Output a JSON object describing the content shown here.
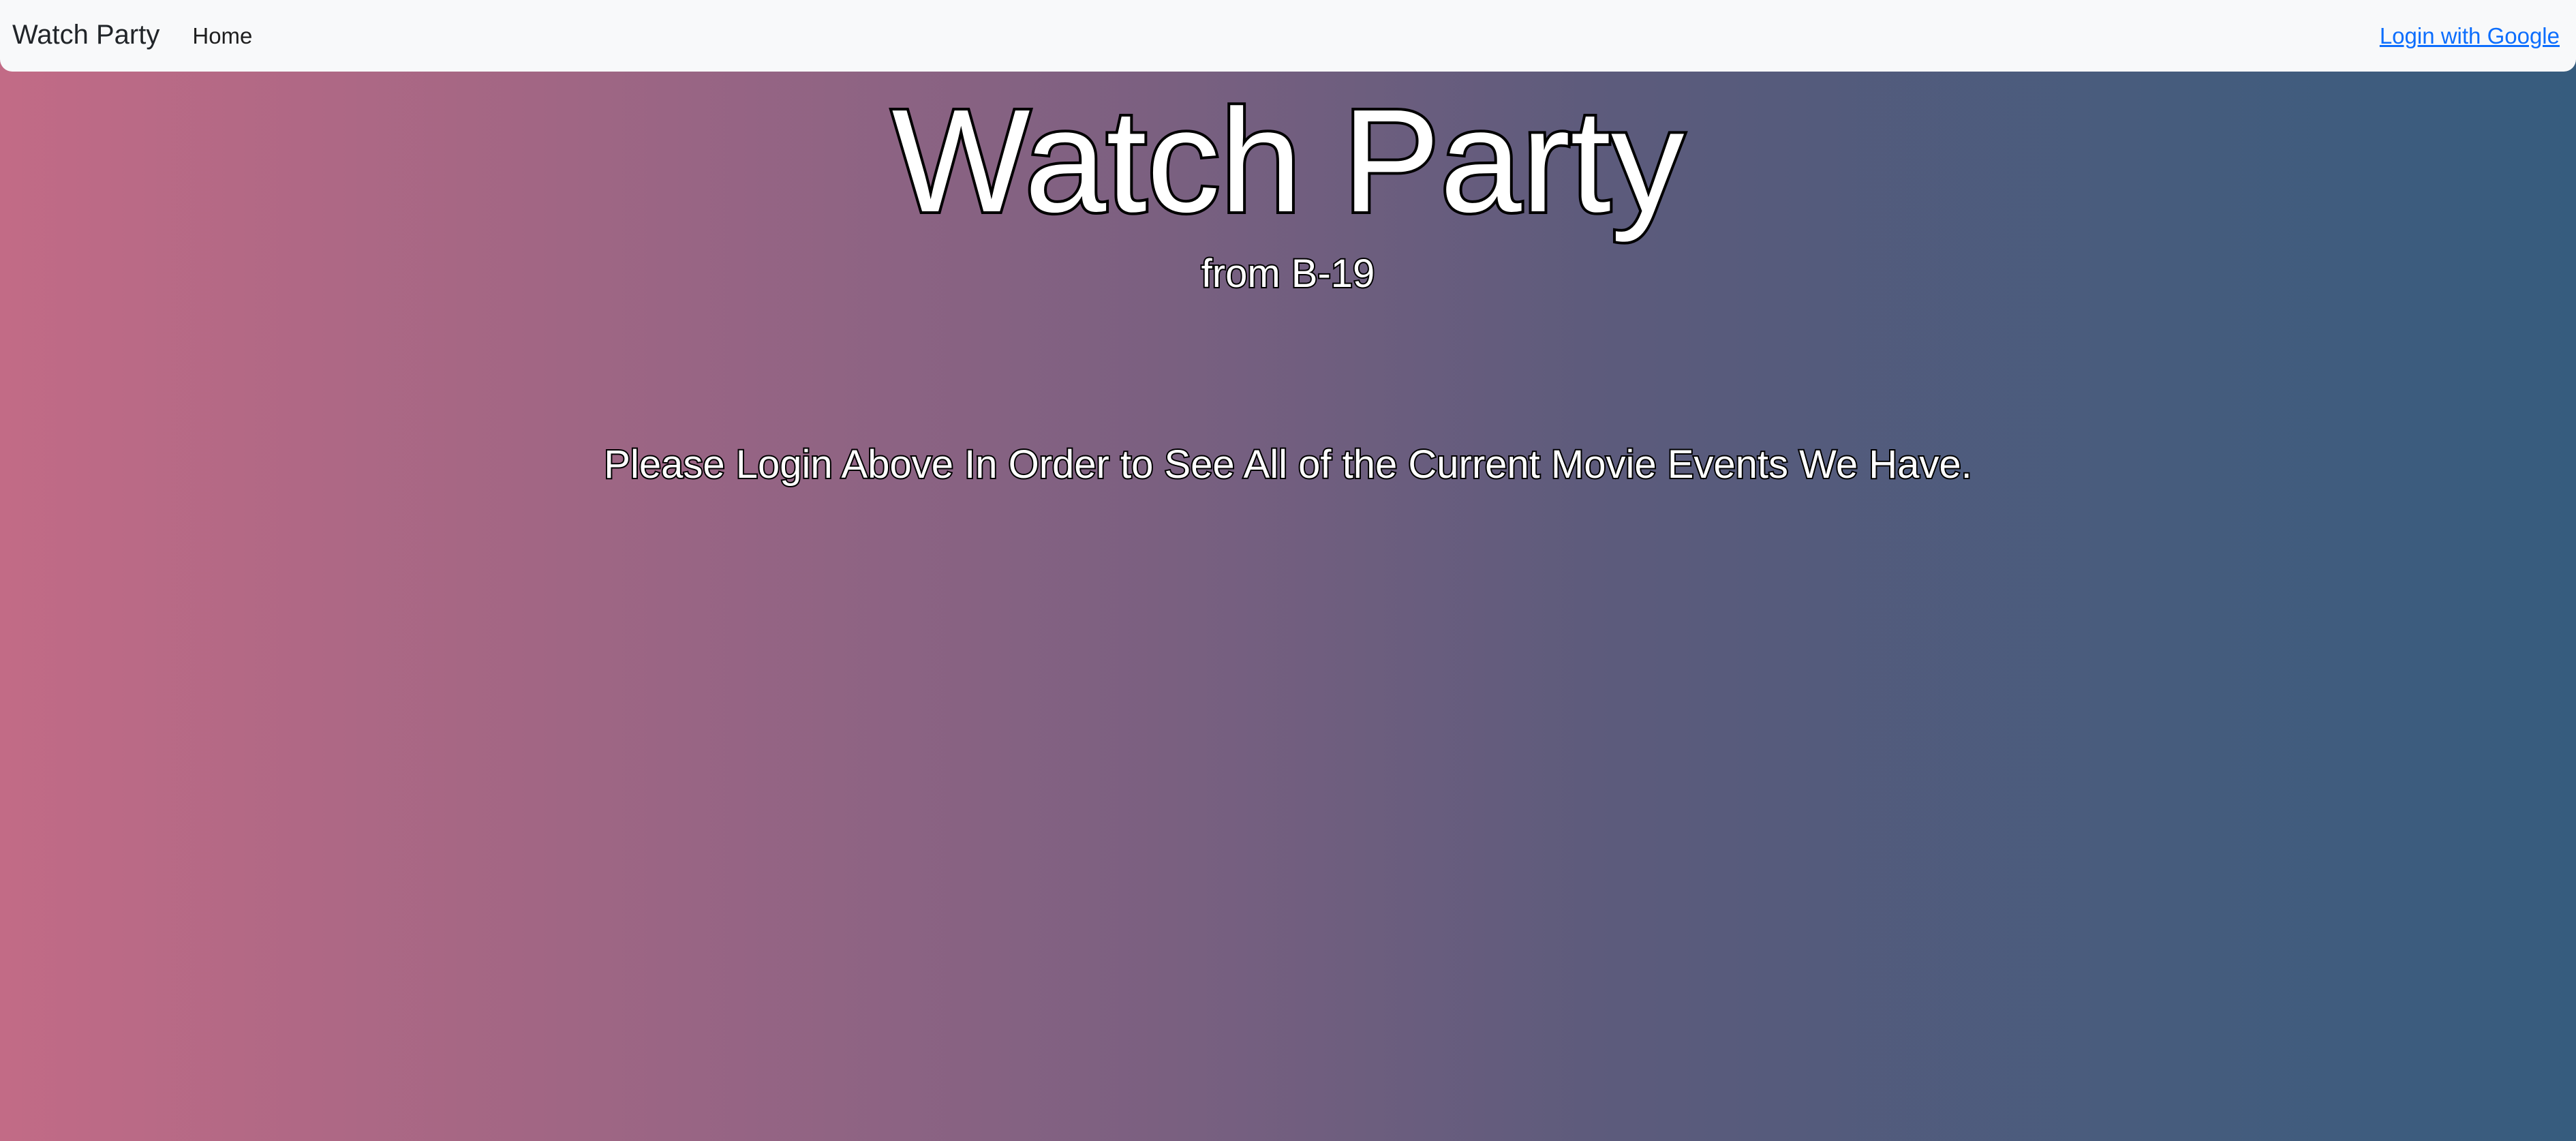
{
  "navbar": {
    "brand": "Watch Party",
    "home_label": "Home",
    "login_label": "Login with Google",
    "background_color": "#f8f9fa",
    "link_color": "#0d6efd"
  },
  "hero": {
    "title": "Watch Party",
    "subtitle": "from B-19",
    "message": "Please Login Above In Order to See All of the Current Movie Events We Have."
  },
  "background": {
    "gradient_start": "#c26b86",
    "gradient_end": "#365c7e"
  }
}
